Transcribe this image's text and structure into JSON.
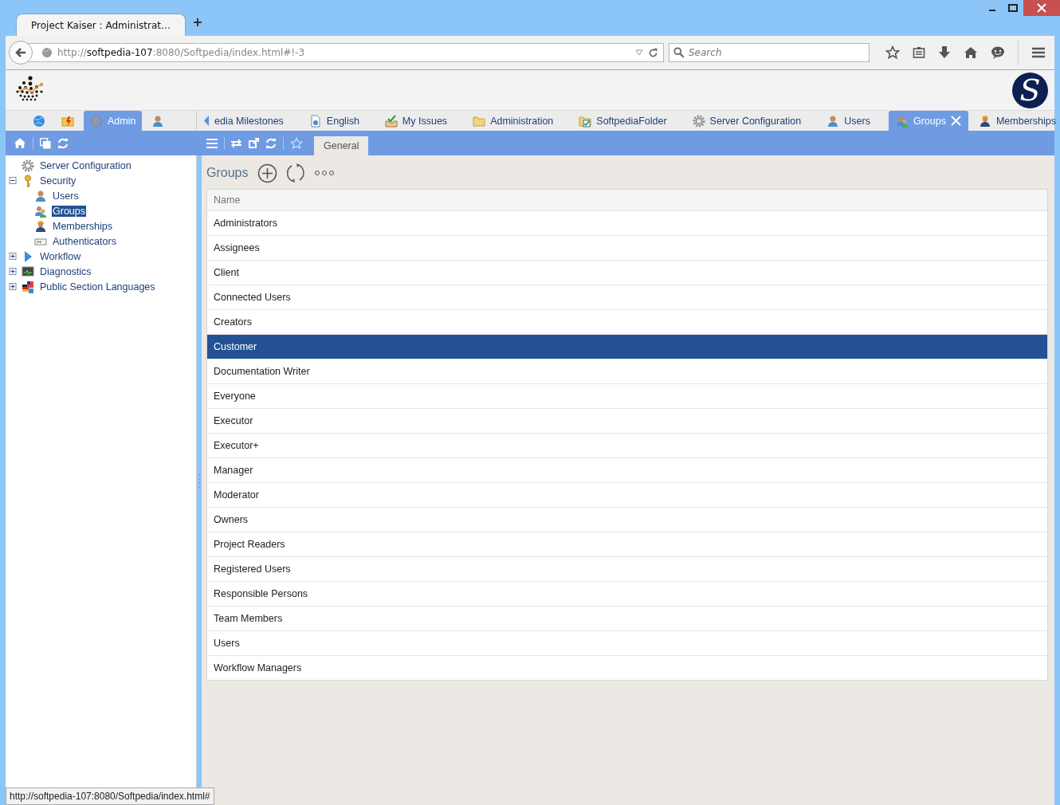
{
  "browser_tab": {
    "title": "Project Kaiser : Administrat…"
  },
  "address": {
    "url": "http://**softpedia-107**:8080/Softpedia/index.html#!-3"
  },
  "search": {
    "placeholder": "Search"
  },
  "brand_mark": "S",
  "left_tabs": [
    {
      "kind": "globe",
      "selected": false
    },
    {
      "kind": "flash-folder",
      "selected": false
    },
    {
      "kind": "gear",
      "label": "Admin",
      "selected": true
    },
    {
      "kind": "person",
      "selected": false
    }
  ],
  "tabs": [
    {
      "label": "edia Milestones",
      "selected": false
    },
    {
      "kind": "doc",
      "label": "English",
      "selected": false
    },
    {
      "kind": "inbox",
      "label": "My Issues",
      "selected": false
    },
    {
      "kind": "folder",
      "label": "Administration",
      "selected": false
    },
    {
      "kind": "folder-check",
      "label": "SoftpediaFolder",
      "selected": false
    },
    {
      "kind": "gear",
      "label": "Server Configuration",
      "selected": false
    },
    {
      "kind": "person",
      "label": "Users",
      "selected": false
    },
    {
      "kind": "group",
      "label": "Groups",
      "selected": true
    },
    {
      "kind": "worker",
      "label": "Memberships",
      "selected": false
    }
  ],
  "view_tabs": [
    {
      "label": "General",
      "selected": true
    }
  ],
  "tree": [
    {
      "kind": "gear",
      "label": "Server Configuration",
      "selected": false
    },
    {
      "kind": "key",
      "label": "Security",
      "selected": false,
      "expanded": true,
      "children": [
        {
          "kind": "person",
          "label": "Users",
          "selected": false
        },
        {
          "kind": "group",
          "label": "Groups",
          "selected": true
        },
        {
          "kind": "worker",
          "label": "Memberships",
          "selected": false
        },
        {
          "kind": "card",
          "label": "Authenticators",
          "selected": false
        }
      ]
    },
    {
      "kind": "play",
      "label": "Workflow",
      "selected": false,
      "expanded": false
    },
    {
      "kind": "monitor",
      "label": "Diagnostics",
      "selected": false,
      "expanded": false
    },
    {
      "kind": "flag",
      "label": "Public Section Languages",
      "selected": false,
      "expanded": false
    }
  ],
  "panel": {
    "title": "Groups",
    "column": "Name",
    "rows": [
      {
        "name": "Administrators",
        "selected": false
      },
      {
        "name": "Assignees",
        "selected": false
      },
      {
        "name": "Client",
        "selected": false
      },
      {
        "name": "Connected Users",
        "selected": false
      },
      {
        "name": "Creators",
        "selected": false
      },
      {
        "name": "Customer",
        "selected": true
      },
      {
        "name": "Documentation Writer",
        "selected": false
      },
      {
        "name": "Everyone",
        "selected": false
      },
      {
        "name": "Executor",
        "selected": false
      },
      {
        "name": "Executor+",
        "selected": false
      },
      {
        "name": "Manager",
        "selected": false
      },
      {
        "name": "Moderator",
        "selected": false
      },
      {
        "name": "Owners",
        "selected": false
      },
      {
        "name": "Project Readers",
        "selected": false
      },
      {
        "name": "Registered Users",
        "selected": false
      },
      {
        "name": "Responsible Persons",
        "selected": false
      },
      {
        "name": "Team Members",
        "selected": false
      },
      {
        "name": "Users",
        "selected": false
      },
      {
        "name": "Workflow Managers",
        "selected": false
      }
    ]
  },
  "status_url": "http://softpedia-107:8080/Softpedia/index.html#"
}
